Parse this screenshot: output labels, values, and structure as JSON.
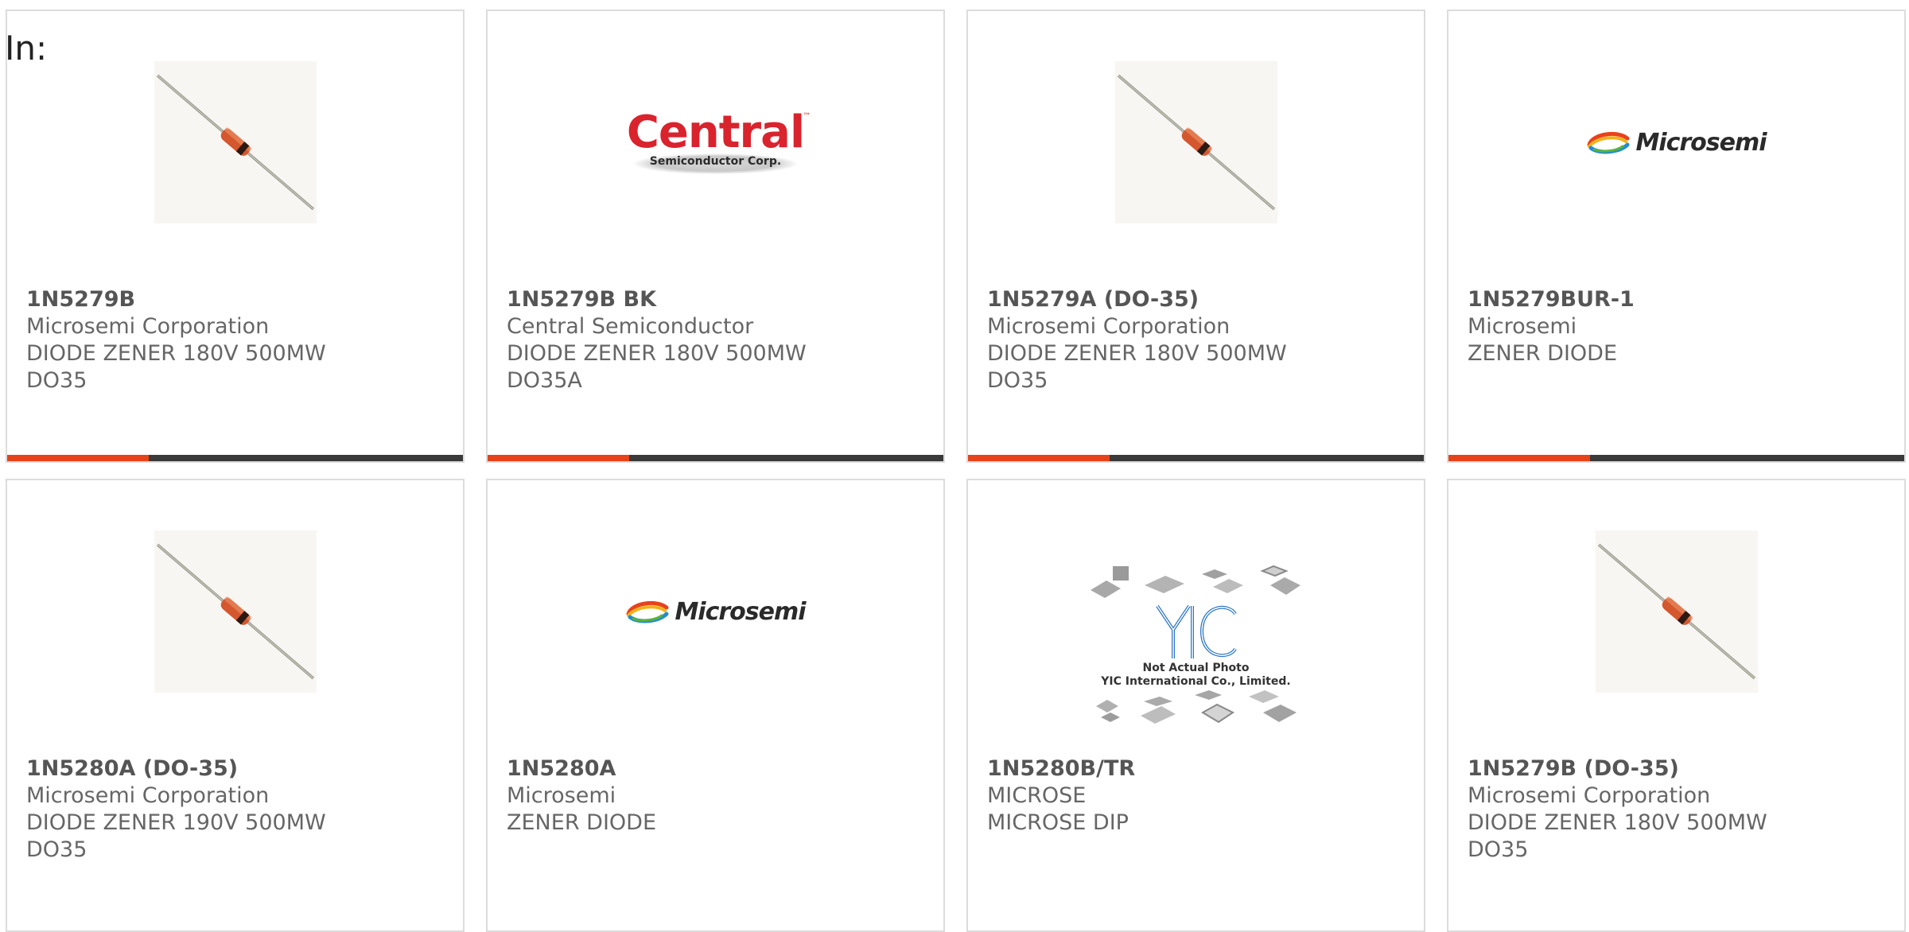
{
  "header": {
    "in_label": "In:"
  },
  "colors": {
    "accent": "#e8421c",
    "track": "#3a3a3a",
    "border": "#dcdcdc",
    "text": "#666666"
  },
  "images": {
    "central_logo": {
      "word": "Central",
      "tm": "™",
      "sub": "Semiconductor Corp."
    },
    "microsemi_logo": {
      "word": "Microsemi"
    },
    "yic": {
      "note_line1": "Not Actual Photo",
      "note_line2": "YIC International Co., Limited."
    }
  },
  "products": [
    {
      "part": "1N5279B",
      "manufacturer": "Microsemi Corporation",
      "line1": "DIODE ZENER 180V 500MW",
      "line2": "DO35",
      "image": "diode-photo",
      "progress": 0.31
    },
    {
      "part": "1N5279B BK",
      "manufacturer": "Central Semiconductor",
      "line1": "DIODE ZENER 180V 500MW",
      "line2": "DO35A",
      "image": "central-logo",
      "progress": 0.31
    },
    {
      "part": "1N5279A (DO-35)",
      "manufacturer": "Microsemi Corporation",
      "line1": "DIODE ZENER 180V 500MW",
      "line2": "DO35",
      "image": "diode-photo",
      "progress": 0.31
    },
    {
      "part": "1N5279BUR-1",
      "manufacturer": "Microsemi",
      "line1": "ZENER DIODE",
      "line2": "",
      "image": "microsemi-logo",
      "progress": 0.31
    },
    {
      "part": "1N5280A (DO-35)",
      "manufacturer": "Microsemi Corporation",
      "line1": "DIODE ZENER 190V 500MW",
      "line2": "DO35",
      "image": "diode-photo"
    },
    {
      "part": "1N5280A",
      "manufacturer": "Microsemi",
      "line1": "ZENER DIODE",
      "line2": "",
      "image": "microsemi-logo"
    },
    {
      "part": "1N5280B/TR",
      "manufacturer": "MICROSE",
      "line1": "MICROSE DIP",
      "line2": "",
      "image": "yic-placeholder"
    },
    {
      "part": "1N5279B (DO-35)",
      "manufacturer": "Microsemi Corporation",
      "line1": "DIODE ZENER 180V 500MW",
      "line2": "DO35",
      "image": "diode-photo"
    }
  ]
}
